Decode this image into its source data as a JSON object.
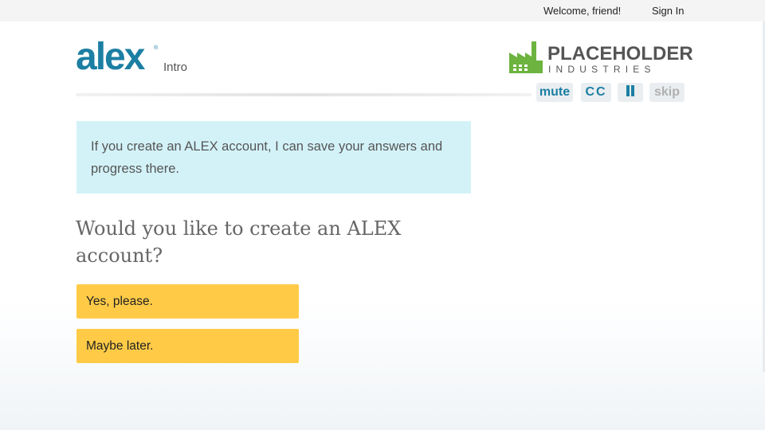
{
  "topbar": {
    "welcome_text": "Welcome, friend!",
    "sign_in_label": "Sign In"
  },
  "header": {
    "logo_text": "alex",
    "logo_mark": "®",
    "section_name": "Intro",
    "brand_name": "PLACEHOLDER",
    "brand_subtitle": "INDUSTRIES",
    "brand_icon": "factory-icon",
    "brand_color": "#6cb33f"
  },
  "controls": {
    "mute_label": "mute",
    "cc_label": "CC",
    "pause_icon": "pause-icon",
    "skip_label": "skip"
  },
  "message": {
    "text": "If you create an ALEX account, I can save your answers and progress there."
  },
  "question": {
    "text": "Would you like to create an ALEX account?"
  },
  "options": [
    {
      "label": "Yes, please."
    },
    {
      "label": "Maybe later."
    }
  ],
  "colors": {
    "accent": "#1c7fa3",
    "message_background": "#d3f2f8",
    "option_background": "#ffcb47",
    "disabled_control": "#b0b0b0"
  }
}
